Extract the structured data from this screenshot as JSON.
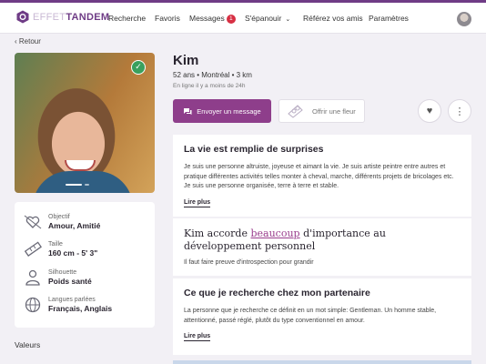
{
  "header": {
    "logo_light": "EFFET",
    "logo_bold": "TANDEM",
    "nav": [
      {
        "label": "Recherche"
      },
      {
        "label": "Favoris"
      },
      {
        "label": "Messages",
        "badge": "1"
      },
      {
        "label": "S'épanouir"
      },
      {
        "label": "Référez vos amis"
      },
      {
        "label": "Paramètres"
      }
    ]
  },
  "back_label": "Retour",
  "profile": {
    "name": "Kim",
    "meta": "52 ans • Montréal • 3 km",
    "online": "En ligne il y a moins de 24h",
    "send_message": "Envoyer un message",
    "offer_flower": "Offrir une fleur"
  },
  "info": [
    {
      "icon": "heart-arrow-icon",
      "label": "Objectif",
      "value": "Amour, Amitié"
    },
    {
      "icon": "ruler-icon",
      "label": "Taille",
      "value": "160 cm - 5' 3\""
    },
    {
      "icon": "silhouette-icon",
      "label": "Silhouette",
      "value": "Poids santé"
    },
    {
      "icon": "globe-icon",
      "label": "Langues parlées",
      "value": "Français, Anglais"
    }
  ],
  "valeurs_label": "Valeurs",
  "sections": [
    {
      "title": "La vie est remplie de surprises",
      "text": "Je suis une personne altruiste, joyeuse et aimant la vie. Je suis artiste peintre entre autres et pratique différentes activités telles monter à cheval, marche, différents projets de bricolages etc. Je suis une personne organisée, terre à terre et stable.",
      "more": "Lire plus"
    },
    {
      "title_pre": "Kim accorde ",
      "title_hl": "beaucoup",
      "title_post": " d'importance au développement personnel",
      "text": "Il faut faire preuve d'introspection pour grandir"
    },
    {
      "title": "Ce que je recherche chez mon partenaire",
      "text": "La personne que je recherche ce définit en un mot simple: Gentleman. Un homme stable, attentionné, passé réglé, plutôt du type conventionnel en amour.",
      "more": "Lire plus"
    }
  ],
  "colors": {
    "brand": "#6f3c86",
    "button": "#8e3e8b",
    "badge": "#d72f43",
    "verified": "#3aa05d"
  }
}
